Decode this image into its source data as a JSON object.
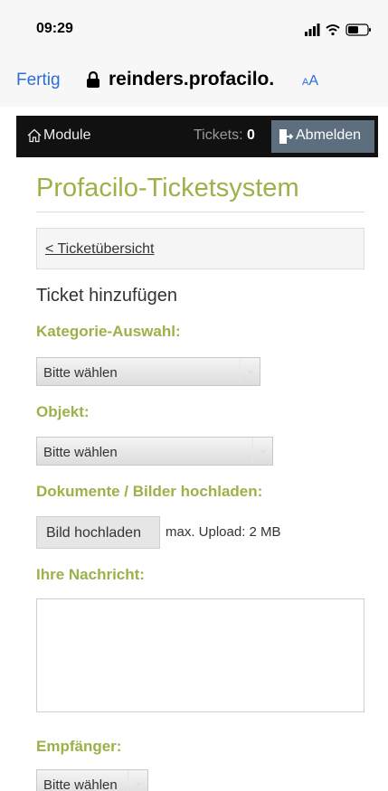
{
  "status_bar": {
    "time": "09:29"
  },
  "browser": {
    "done_label": "Fertig",
    "domain": "reinders.profacilo.",
    "text_size_small": "A",
    "text_size_large": "A"
  },
  "navbar": {
    "module_label": "Module",
    "tickets_label": "Tickets:",
    "tickets_count": "0",
    "logout_label": "Abmelden"
  },
  "page": {
    "title": "Profacilo-Ticketsystem",
    "back_link": "< Ticketübersicht",
    "form_heading": "Ticket hinzufügen"
  },
  "form": {
    "category": {
      "label": "Kategorie-Auswahl:",
      "value": "Bitte wählen"
    },
    "object": {
      "label": "Objekt:",
      "value": "Bitte wählen"
    },
    "upload": {
      "label": "Dokumente / Bilder hochladen:",
      "button": "Bild hochladen",
      "hint": "max. Upload: 2 MB"
    },
    "message": {
      "label": "Ihre Nachricht:",
      "value": ""
    },
    "recipient": {
      "label": "Empfänger:",
      "value": "Bitte wählen"
    }
  },
  "colors": {
    "accent": "#9ab248",
    "link": "#2b6fd6",
    "navbar": "#111111",
    "logout_button": "#5d6f7e"
  }
}
